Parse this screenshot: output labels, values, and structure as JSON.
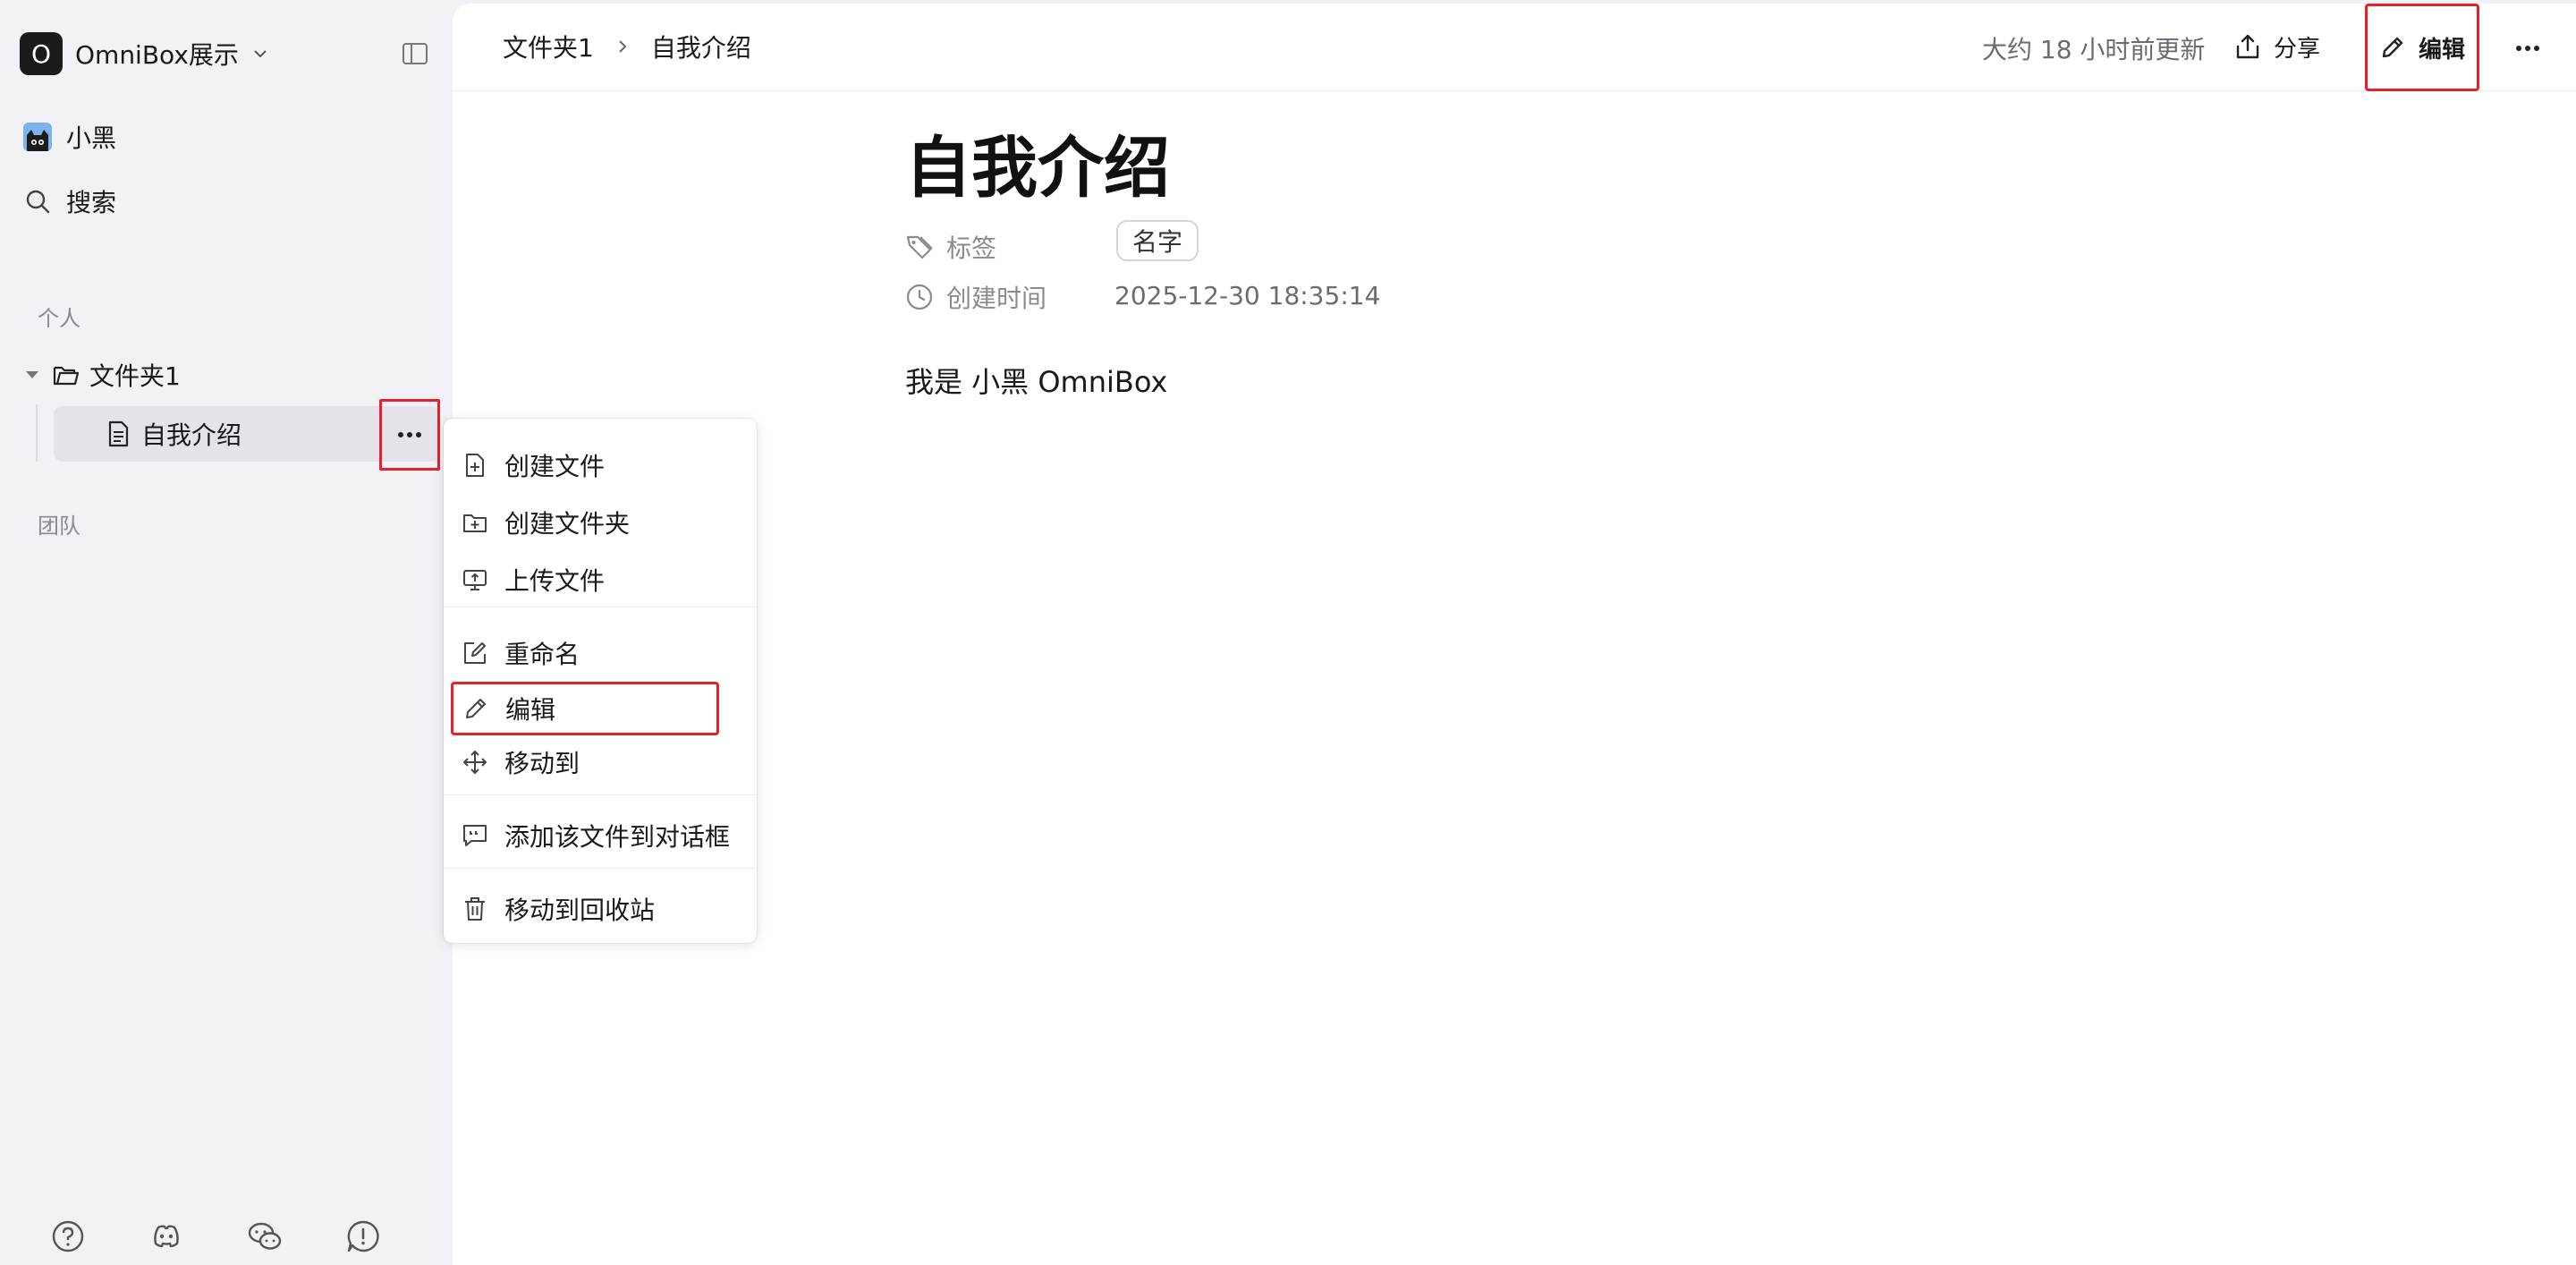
{
  "workspace": {
    "logo_letter": "O",
    "name": "OmniBox展示"
  },
  "sidebar": {
    "user_name": "小黑",
    "search_label": "搜索",
    "section_personal": "个人",
    "section_team": "团队",
    "folder_name": "文件夹1",
    "file_name": "自我介绍"
  },
  "topbar": {
    "breadcrumb": [
      "文件夹1",
      "自我介绍"
    ],
    "updated": "大约 18 小时前更新",
    "share_label": "分享",
    "edit_label": "编辑"
  },
  "document": {
    "title": "自我介绍",
    "tags_label": "标签",
    "tag": "名字",
    "created_label": "创建时间",
    "created_value": "2025-12-30 18:35:14",
    "body": "我是 小黑 OmniBox"
  },
  "context_menu": {
    "items": [
      "创建文件",
      "创建文件夹",
      "上传文件",
      "重命名",
      "编辑",
      "移动到",
      "添加该文件到对话框",
      "移动到回收站"
    ]
  },
  "colors": {
    "highlight": "#e8202a",
    "sidebar_bg": "#f1f1f6",
    "main_bg": "#ffffff"
  }
}
